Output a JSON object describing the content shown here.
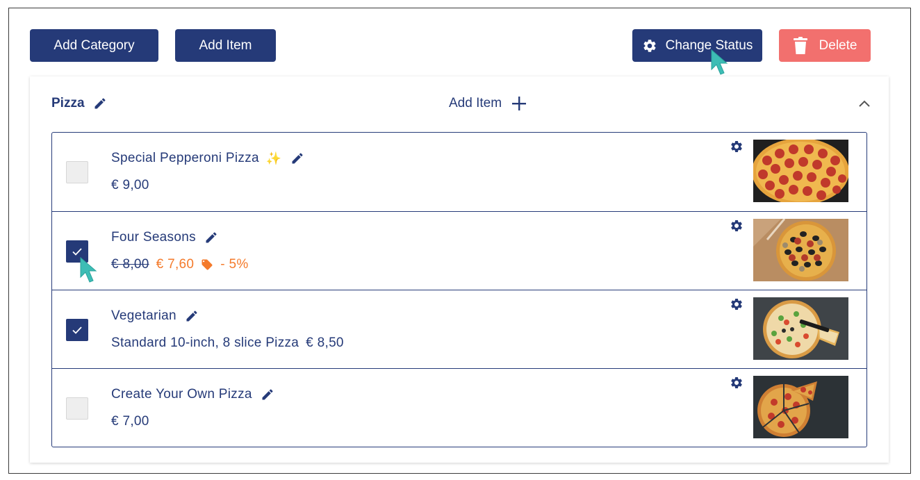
{
  "toolbar": {
    "add_category": "Add Category",
    "add_item": "Add Item",
    "change_status": "Change Status",
    "delete": "Delete"
  },
  "category": {
    "title": "Pizza",
    "add_item": "Add Item"
  },
  "items": [
    {
      "name": "Special Pepperoni Pizza",
      "emoji": "✨",
      "checked": false,
      "price": "€ 9,00"
    },
    {
      "name": "Four Seasons",
      "checked": true,
      "old_price": "€ 8,00",
      "new_price": "€ 7,60",
      "discount": "- 5%"
    },
    {
      "name": "Vegetarian",
      "checked": true,
      "description": "Standard 10-inch, 8 slice Pizza",
      "price": "€ 8,50"
    },
    {
      "name": "Create Your Own Pizza",
      "checked": false,
      "price": "€ 7,00"
    }
  ],
  "colors": {
    "navy": "#253a78",
    "delete_red": "#f2706e",
    "discount_orange": "#f47a2b",
    "cursor_teal": "#3dbdb5"
  }
}
